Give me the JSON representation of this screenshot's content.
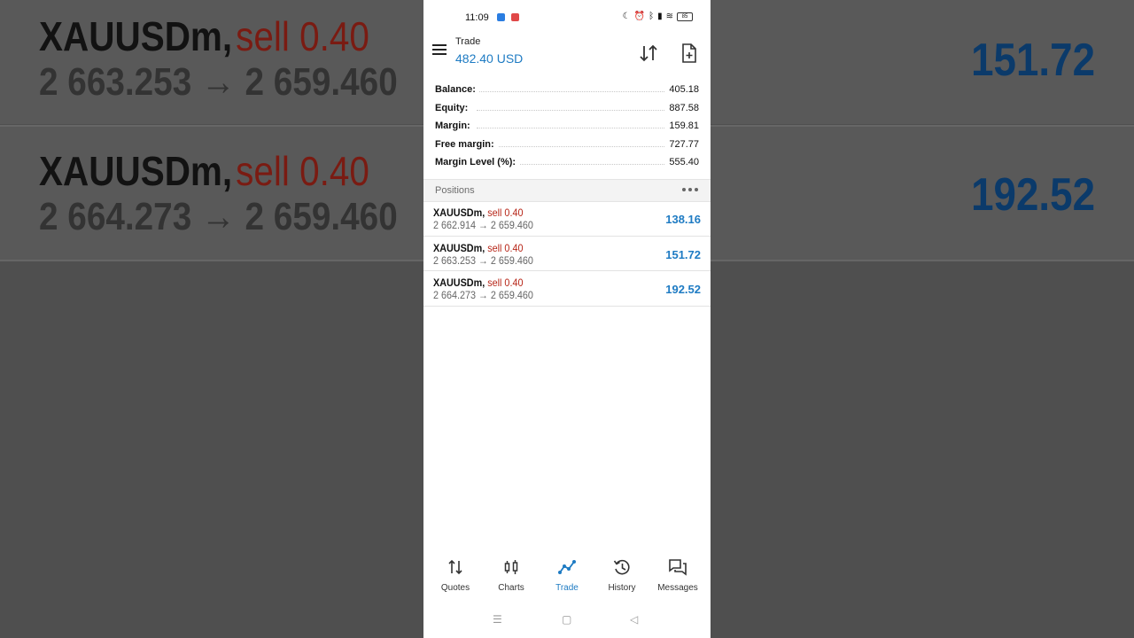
{
  "status_bar": {
    "time": "11:09",
    "battery": "85"
  },
  "header": {
    "title": "Trade",
    "subtitle": "482.40 USD"
  },
  "summary": [
    {
      "label": "Balance:",
      "value": "405.18"
    },
    {
      "label": "Equity:",
      "value": "887.58"
    },
    {
      "label": "Margin:",
      "value": "159.81"
    },
    {
      "label": "Free margin:",
      "value": "727.77"
    },
    {
      "label": "Margin Level (%):",
      "value": "555.40"
    }
  ],
  "positions_header": "Positions",
  "positions": [
    {
      "symbol": "XAUUSDm,",
      "side": "sell 0.40",
      "prices": "2 662.914 → 2 659.460",
      "profit": "138.16"
    },
    {
      "symbol": "XAUUSDm,",
      "side": "sell 0.40",
      "prices": "2 663.253 → 2 659.460",
      "profit": "151.72"
    },
    {
      "symbol": "XAUUSDm,",
      "side": "sell 0.40",
      "prices": "2 664.273 → 2 659.460",
      "profit": "192.52"
    }
  ],
  "nav": [
    {
      "label": "Quotes",
      "icon": "quotes-icon"
    },
    {
      "label": "Charts",
      "icon": "charts-icon"
    },
    {
      "label": "Trade",
      "icon": "trade-icon"
    },
    {
      "label": "History",
      "icon": "history-icon"
    },
    {
      "label": "Messages",
      "icon": "messages-icon"
    }
  ],
  "colors": {
    "accent": "#1e7bc3",
    "sell": "#b8281a",
    "background_blur": "#4f4f4f"
  }
}
